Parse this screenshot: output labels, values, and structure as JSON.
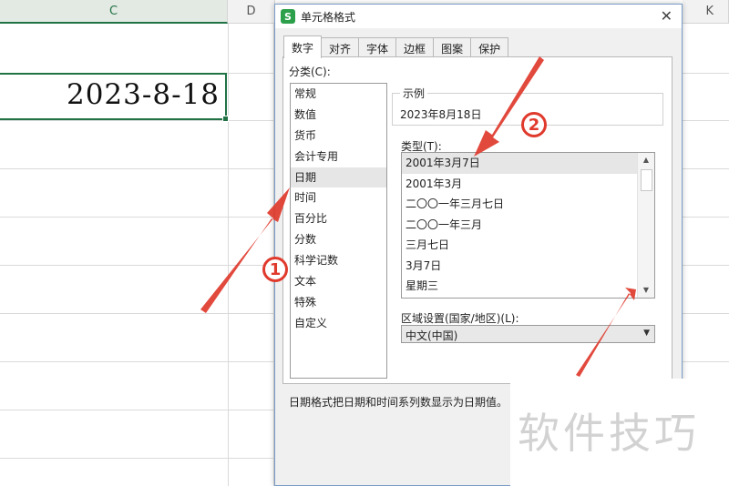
{
  "sheet": {
    "columns": [
      "C",
      "D",
      "K"
    ],
    "cell_value": "2023-8-18"
  },
  "dialog": {
    "title": "单元格格式",
    "app_icon": "S",
    "close_glyph": "✕",
    "tabs": [
      "数字",
      "对齐",
      "字体",
      "边框",
      "图案",
      "保护"
    ],
    "category_label": "分类(C):",
    "categories": [
      "常规",
      "数值",
      "货币",
      "会计专用",
      "日期",
      "时间",
      "百分比",
      "分数",
      "科学记数",
      "文本",
      "特殊",
      "自定义"
    ],
    "selected_category": "日期",
    "sample_legend": "示例",
    "sample_value": "2023年8月18日",
    "type_label": "类型(T):",
    "types": [
      "2001年3月7日",
      "2001年3月",
      "二〇〇一年三月七日",
      "二〇〇一年三月",
      "三月七日",
      "3月7日",
      "星期三"
    ],
    "selected_type": "2001年3月7日",
    "locale_label": "区域设置(国家/地区)(L):",
    "locale_value": "中文(中国)",
    "description": "日期格式把日期和时间系列数显示为日期值。"
  },
  "annotations": {
    "marker_1": "1",
    "marker_2": "2",
    "arrow_color": "#e03a2d",
    "watermark": "软件技巧"
  },
  "colors": {
    "selection_green": "#217346",
    "dialog_bg": "#f0f0f0",
    "dialog_border": "#7a9cc7",
    "app_icon_green": "#2c9f4b"
  }
}
